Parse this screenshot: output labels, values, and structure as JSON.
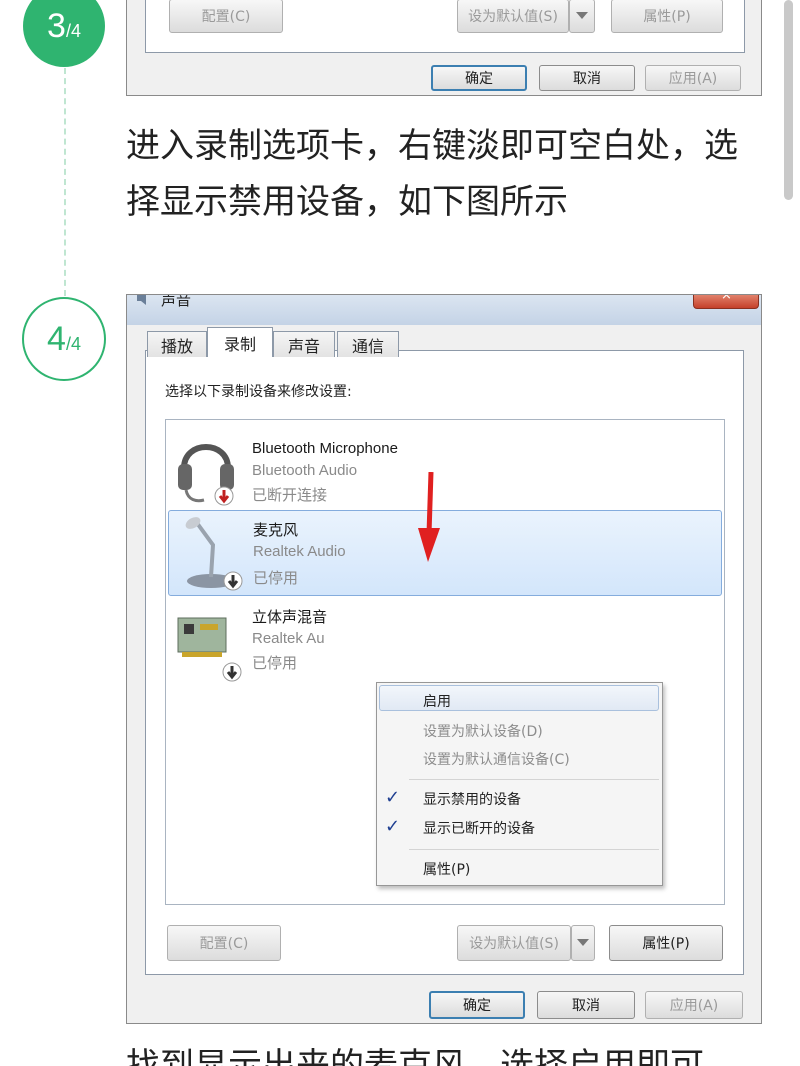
{
  "steps": {
    "step3": {
      "num": "3",
      "den": "/4"
    },
    "step4": {
      "num": "4",
      "den": "/4"
    }
  },
  "top_shot": {
    "configure": "配置(C)",
    "set_default": "设为默认值(S)",
    "properties": "属性(P)",
    "ok": "确定",
    "cancel": "取消",
    "apply": "应用(A)"
  },
  "instruction_step3": "进入录制选项卡，右键淡即可空白处，选择显示禁用设备，如下图所示",
  "dialog": {
    "title": "声音",
    "tabs": [
      "播放",
      "录制",
      "声音",
      "通信"
    ],
    "prompt": "选择以下录制设备来修改设置:",
    "devices": [
      {
        "name": "Bluetooth Microphone",
        "driver": "Bluetooth Audio",
        "status": "已断开连接"
      },
      {
        "name": "麦克风",
        "driver": "Realtek Audio",
        "status": "已停用"
      },
      {
        "name": "立体声混音",
        "driver": "Realtek Au",
        "status": "已停用"
      }
    ],
    "context_menu": {
      "enable": "启用",
      "set_default": "设置为默认设备(D)",
      "set_default_comm": "设置为默认通信设备(C)",
      "show_disabled": "显示禁用的设备",
      "show_disconnected": "显示已断开的设备",
      "properties": "属性(P)",
      "check_glyph": "✓"
    },
    "configure": "配置(C)",
    "set_default": "设为默认值(S)",
    "properties": "属性(P)",
    "ok": "确定",
    "cancel": "取消",
    "apply": "应用(A)"
  },
  "instruction_step4": "找到显示出来的麦克风，选择启用即可",
  "colors": {
    "accent": "#2fb470",
    "arrow": "#e02020",
    "selection": "#d3e6fb"
  },
  "icons": [
    "headset-icon",
    "microphone-icon",
    "sound-card-icon",
    "disabled-badge-icon",
    "dropdown-arrow-icon",
    "close-icon"
  ]
}
